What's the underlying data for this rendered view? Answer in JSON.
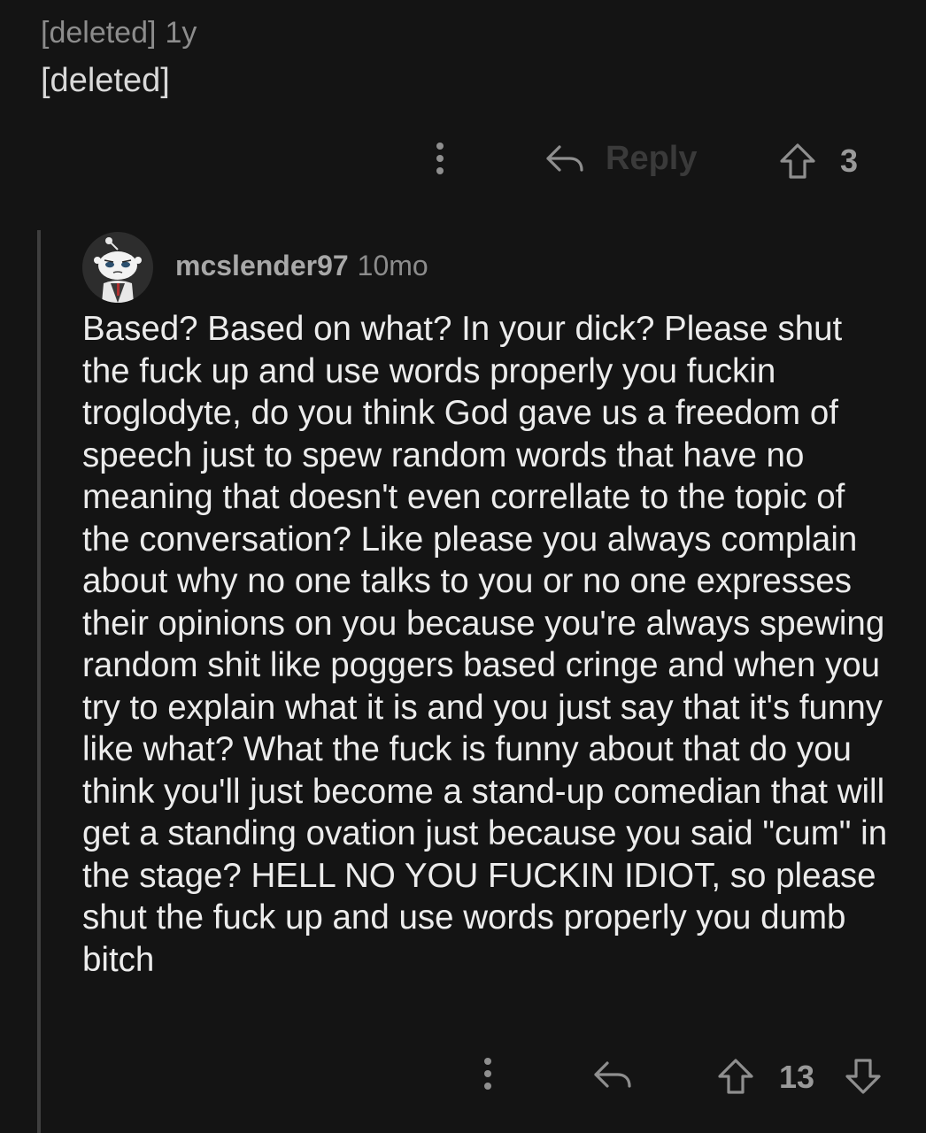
{
  "parent_comment": {
    "author": "[deleted]",
    "age": "1y",
    "body": "[deleted]",
    "reply_label": "Reply",
    "score": "3"
  },
  "reply_comment": {
    "author": "mcslender97",
    "age": "10mo",
    "avatar_icon": "snoo-avatar",
    "body": "Based? Based on what? In your dick? Please shut the fuck up and use words properly you fuckin troglodyte, do you think God gave us a freedom of speech just to spew random words that have no meaning that doesn't even correllate to the topic of the conversation? Like please you always complain about why no one talks to you or no one expresses their opinions on you because you're always spewing random shit like poggers based cringe and when you try to explain what it is and you just say that it's funny like what? What the fuck is funny about that do you think you'll just become a stand-up comedian that will get a standing ovation just because you said \"cum\" in the stage? HELL NO YOU FUCKIN IDIOT, so please shut the fuck up and use words properly you dumb bitch",
    "score": "13"
  },
  "colors": {
    "background": "#141414",
    "text": "#ececec",
    "muted": "#8c8c8c",
    "thread_line": "#3f3f3f"
  }
}
